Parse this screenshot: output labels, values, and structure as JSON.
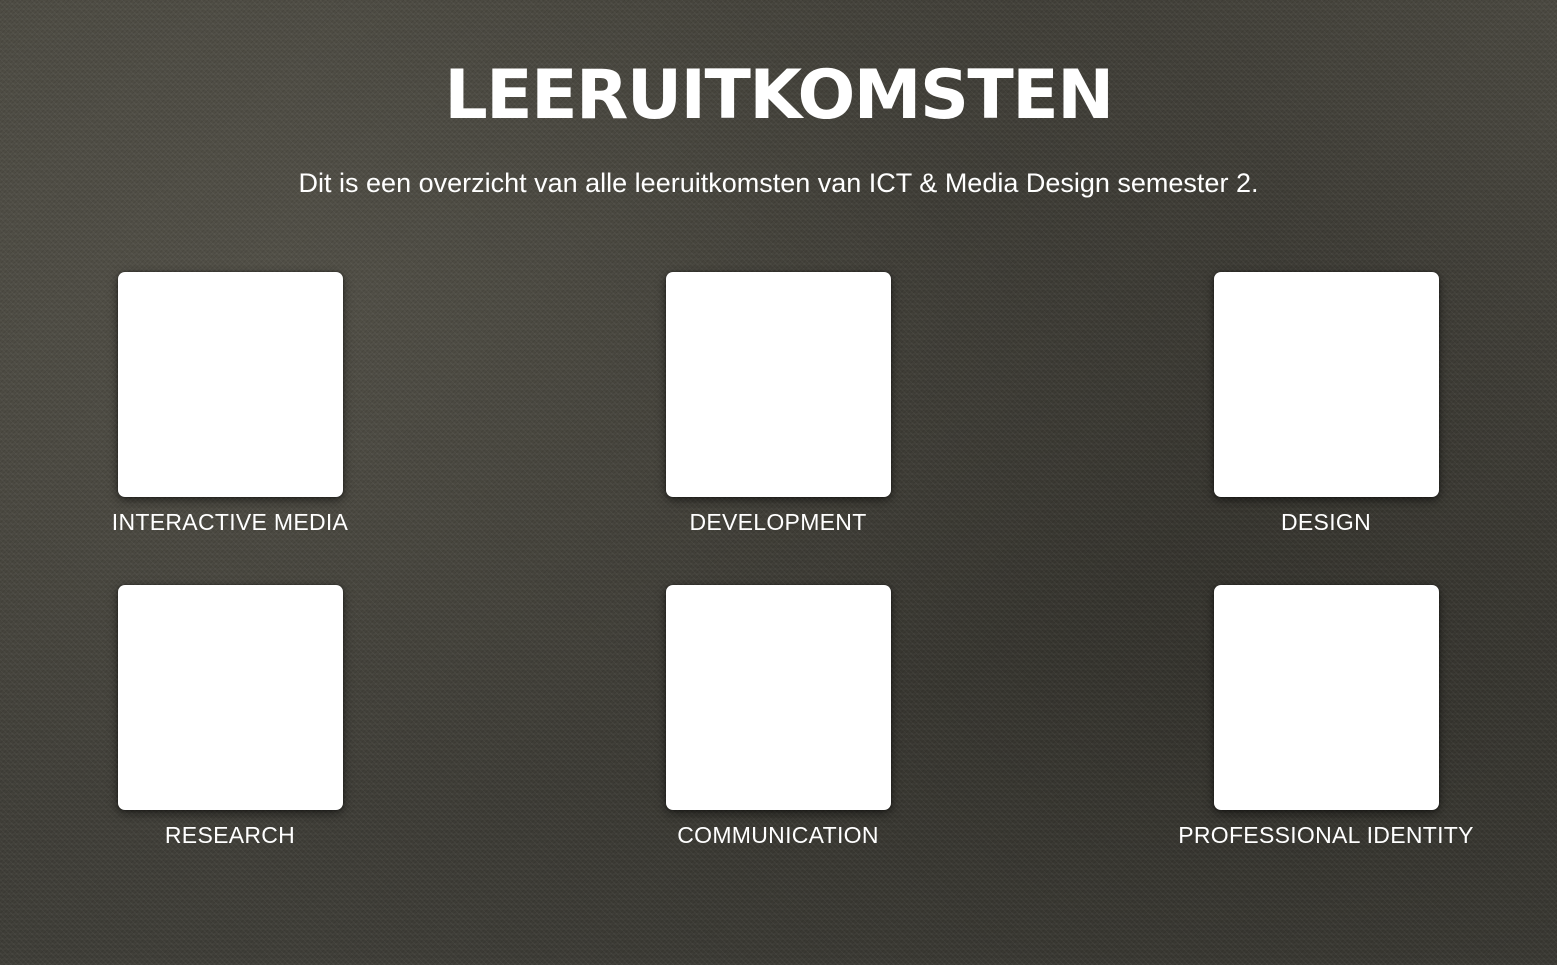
{
  "header": {
    "title": "LEERUITKOMSTEN",
    "subtitle": "Dit is een overzicht van alle leeruitkomsten van ICT & Media Design semester 2."
  },
  "cards": [
    {
      "label": "INTERACTIVE MEDIA"
    },
    {
      "label": "DEVELOPMENT"
    },
    {
      "label": "DESIGN"
    },
    {
      "label": "RESEARCH"
    },
    {
      "label": "COMMUNICATION"
    },
    {
      "label": "PROFESSIONAL IDENTITY"
    }
  ],
  "colors": {
    "background": "#4b4942",
    "text": "#ffffff",
    "card": "#ffffff"
  }
}
